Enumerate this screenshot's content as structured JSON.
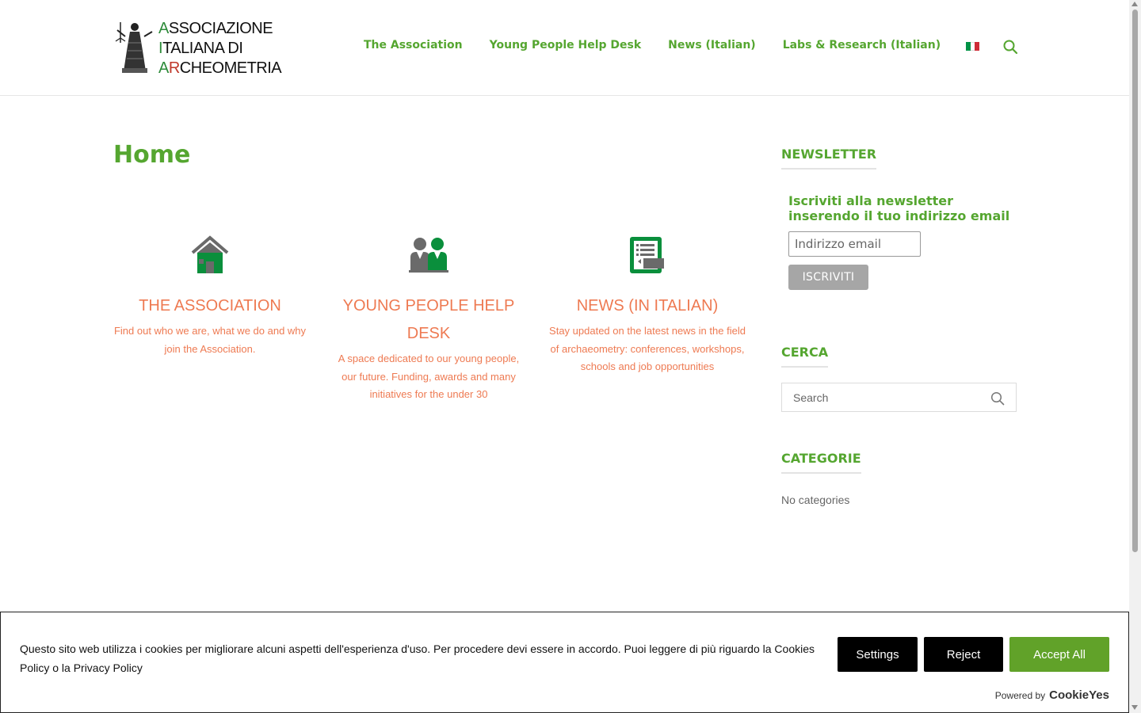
{
  "header": {
    "logo": {
      "line1": "ASSOCIAZIONE",
      "line2": "ITALIANA DI",
      "line3": "ARCHEOMETRIA"
    },
    "nav": [
      {
        "label": "The Association"
      },
      {
        "label": "Young People Help Desk"
      },
      {
        "label": "News (Italian)"
      },
      {
        "label": "Labs & Research (Italian)"
      }
    ],
    "flag_colors": [
      "#009246",
      "#ffffff",
      "#ce2b37"
    ]
  },
  "main": {
    "title": "Home",
    "features": [
      {
        "icon": "house-icon",
        "title": "THE ASSOCIATION",
        "description": "Find out who we are, what we do and why join the Association."
      },
      {
        "icon": "people-icon",
        "title": "YOUNG PEOPLE HELP DESK",
        "description": "A space dedicated to our young people, our future. Funding, awards and many initiatives for the under 30"
      },
      {
        "icon": "news-icon",
        "title": "NEWS (IN ITALIAN)",
        "description": "Stay updated on the latest news in the field of archaeometry: conferences, workshops, schools and job opportunities"
      }
    ]
  },
  "sidebar": {
    "newsletter": {
      "title": "NEWSLETTER",
      "text": "Iscriviti alla newsletter inserendo il tuo indirizzo email",
      "placeholder": "Indirizzo email",
      "button": "ISCRIVITI"
    },
    "search": {
      "title": "CERCA",
      "placeholder": "Search"
    },
    "categories": {
      "title": "CATEGORIE",
      "empty": "No categories"
    }
  },
  "cookie_banner": {
    "message": "Questo sito web utilizza i cookies per migliorare alcuni aspetti dell'esperienza d'uso. Per procedere devi essere in accordo. Puoi leggere di più riguardo la Cookies Policy o la Privacy Policy",
    "settings": "Settings",
    "reject": "Reject",
    "accept": "Accept All",
    "powered_by": "Powered by",
    "brand": "CookieYes"
  },
  "colors": {
    "brand_green": "#55a630",
    "accent_orange": "#ee7a52",
    "icon_green": "#0a8f3c",
    "icon_gray": "#6a6a6a",
    "accept_green": "#61a229"
  }
}
